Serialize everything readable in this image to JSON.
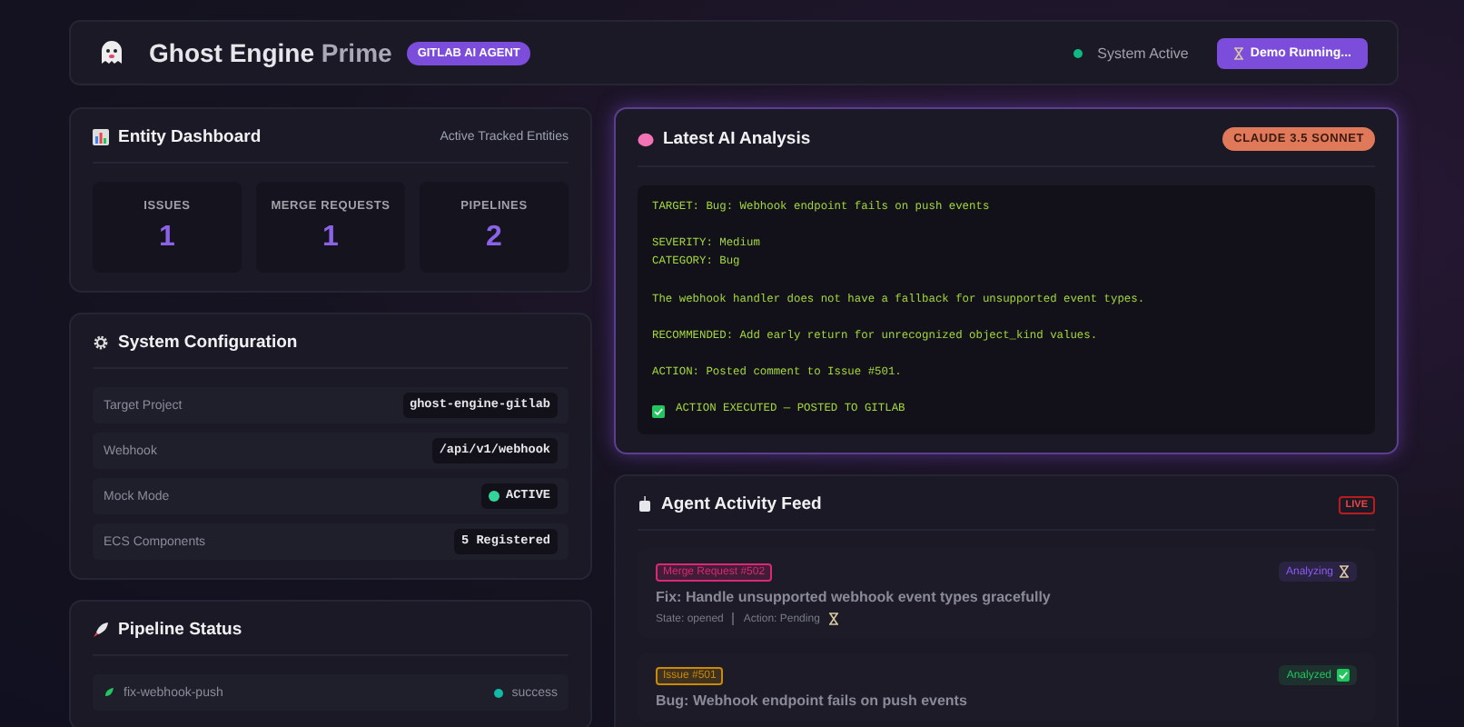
{
  "header": {
    "title": "Ghost Engine",
    "title_suffix": "Prime",
    "badge": "GITLAB AI AGENT",
    "status": {
      "label": "System Active",
      "active": true
    },
    "button": "Demo Running..."
  },
  "entity_dashboard": {
    "title": "Entity Dashboard",
    "subtitle": "Active Tracked Entities",
    "stats": [
      {
        "label": "ISSUES",
        "value": "1"
      },
      {
        "label": "MERGE REQUESTS",
        "value": "1"
      },
      {
        "label": "PIPELINES",
        "value": "2"
      }
    ]
  },
  "system_configuration": {
    "title": "System Configuration",
    "rows": [
      {
        "label": "Target Project",
        "value": "ghost-engine-gitlab",
        "kind": "code"
      },
      {
        "label": "Webhook",
        "value": "/api/v1/webhook",
        "kind": "code"
      },
      {
        "label": "Mock Mode",
        "value": "ACTIVE",
        "kind": "status",
        "on": true
      },
      {
        "label": "ECS Components",
        "value": "5 Registered",
        "kind": "code"
      }
    ]
  },
  "pipeline_status": {
    "title": "Pipeline Status",
    "rows": [
      {
        "name": "fix-webhook-push",
        "status": "success",
        "color": "#14b8a6"
      }
    ]
  },
  "latest_ai_analysis": {
    "title": "Latest AI Analysis",
    "model": "CLAUDE 3.5 SONNET",
    "paragraphs": [
      [
        "TARGET: Bug: Webhook endpoint fails on push events"
      ],
      [
        "SEVERITY: Medium",
        "CATEGORY: Bug"
      ],
      [
        "The webhook handler does not have a fallback for unsupported event types."
      ],
      [
        "RECOMMENDED: Add early return for unrecognized object_kind values."
      ],
      [
        "ACTION: Posted comment to Issue #501."
      ]
    ],
    "executed": "ACTION EXECUTED — POSTED TO GITLAB"
  },
  "agent_activity_feed": {
    "title": "Agent Activity Feed",
    "live": "LIVE",
    "items": [
      {
        "tag": "Merge Request #502",
        "color": "#db2777",
        "status": "Analyzing",
        "done": false,
        "title": "Fix: Handle unsupported webhook event types gracefully",
        "state": "State: opened",
        "action": "Action: Pending"
      },
      {
        "tag": "Issue #501",
        "color": "#ca8a04",
        "status": "Analyzed",
        "done": true,
        "title": "Bug: Webhook endpoint fails on push events"
      }
    ]
  }
}
